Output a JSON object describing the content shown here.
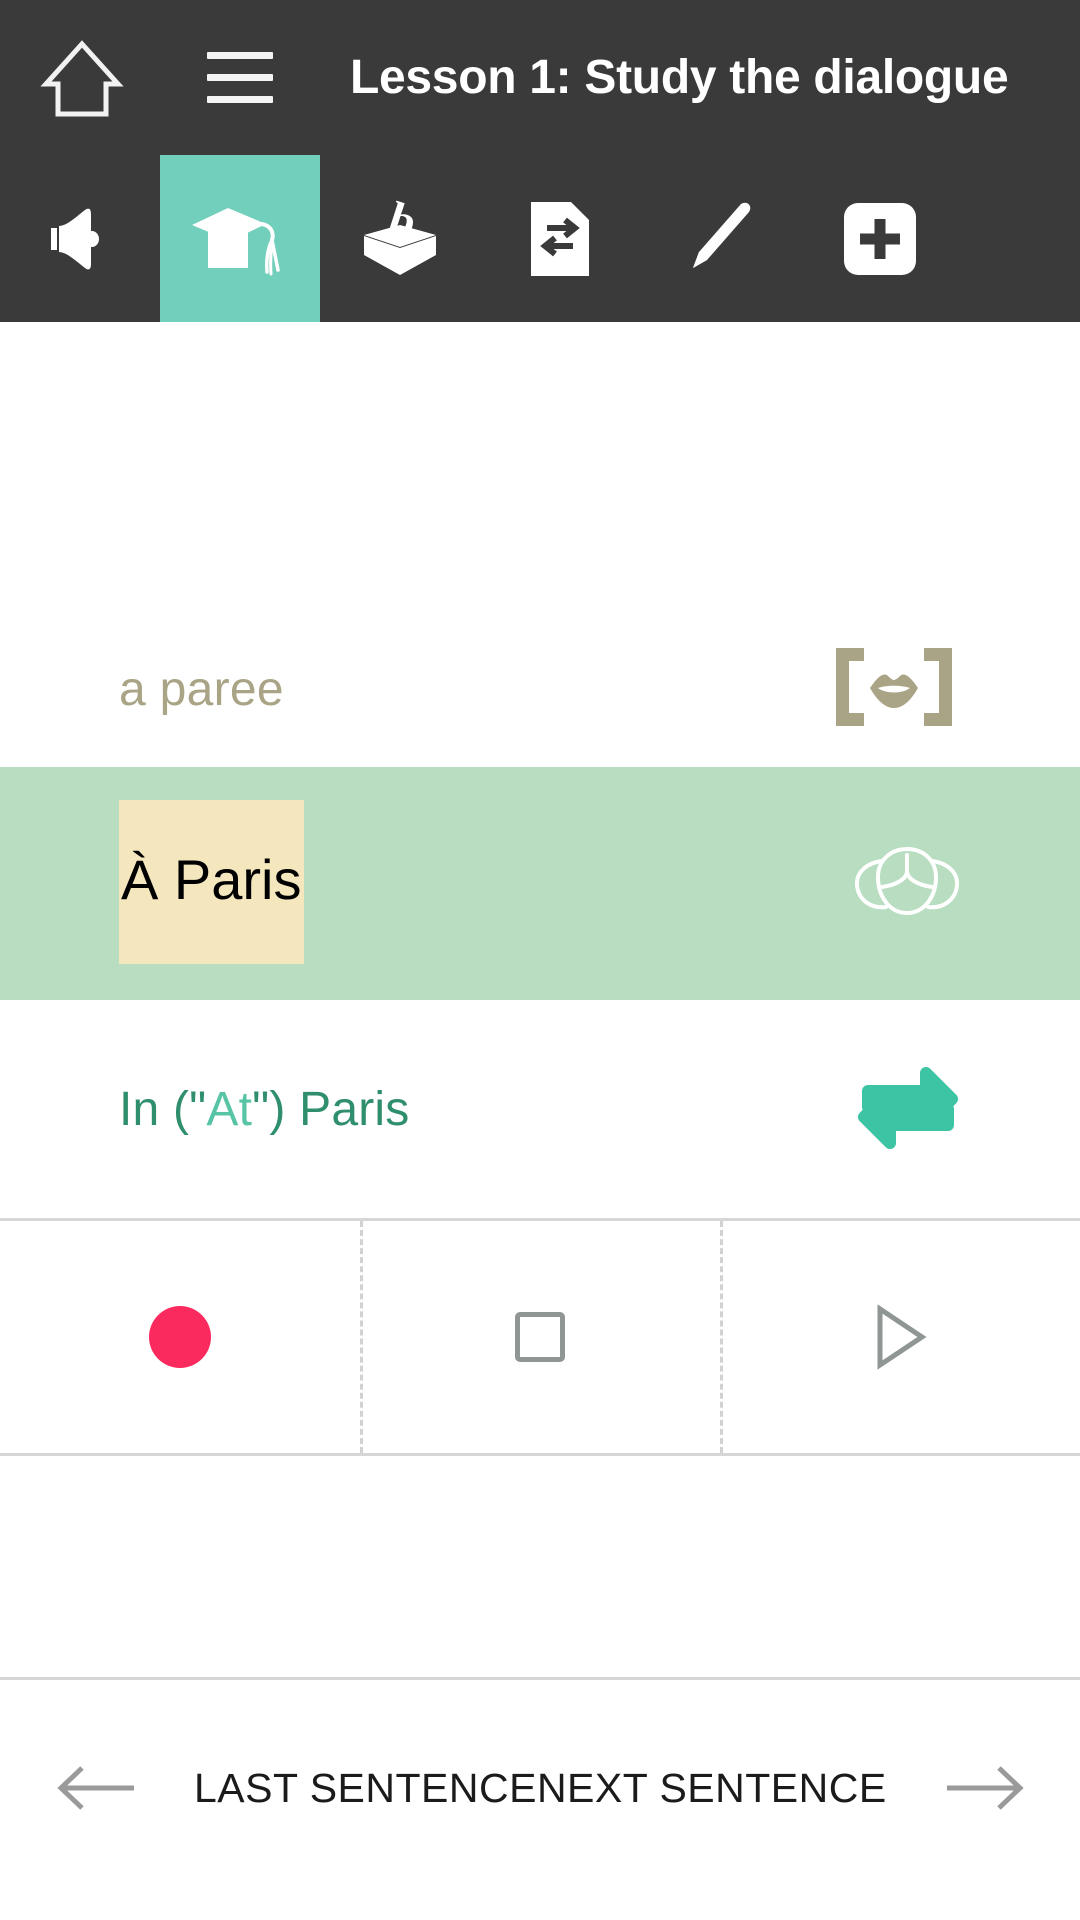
{
  "appbar": {
    "title": "Lesson 1: Study the dialogue",
    "home_icon": "home-icon",
    "menu_icon": "hamburger-menu-icon",
    "background": "#3a3a3a",
    "title_color": "#ffffff"
  },
  "toolbar": {
    "active_index": 1,
    "active_color": "#72cfbb",
    "items": [
      {
        "name": "speaker-icon",
        "label": "Listen"
      },
      {
        "name": "graduation-cap-icon",
        "label": "Study the dialogue"
      },
      {
        "name": "vocabulary-box-icon",
        "label": "Vocabulary"
      },
      {
        "name": "translate-document-icon",
        "label": "Translate"
      },
      {
        "name": "pencil-icon",
        "label": "Write"
      },
      {
        "name": "plus-square-icon",
        "label": "Add"
      }
    ]
  },
  "sentence": {
    "phonetic": "a paree",
    "phonetic_color": "#a9a485",
    "phonetic_icon": "lips-brackets-icon",
    "target": "À Paris",
    "target_row_background": "#b8ddc0",
    "target_highlight_background": "#f4e7bd",
    "target_icon": "head-brain-icon",
    "translation_prefix": "In (\"",
    "translation_alt": "At",
    "translation_suffix": "\") Paris",
    "translation_color": "#2f8f6c",
    "translation_alt_color": "#57c4a5",
    "translation_icon": "swap-arrows-icon"
  },
  "recorder": {
    "record": {
      "name": "record-button",
      "color": "#fa2a5f"
    },
    "stop": {
      "name": "stop-button",
      "color": "#8f9694"
    },
    "play": {
      "name": "play-button",
      "color": "#8f9694"
    }
  },
  "bottomnav": {
    "prev_label": "LAST SENTENCE",
    "next_label": "NEXT SENTENCE",
    "prev_icon": "arrow-left-icon",
    "next_icon": "arrow-right-icon",
    "arrow_color": "#9a9a9a"
  }
}
